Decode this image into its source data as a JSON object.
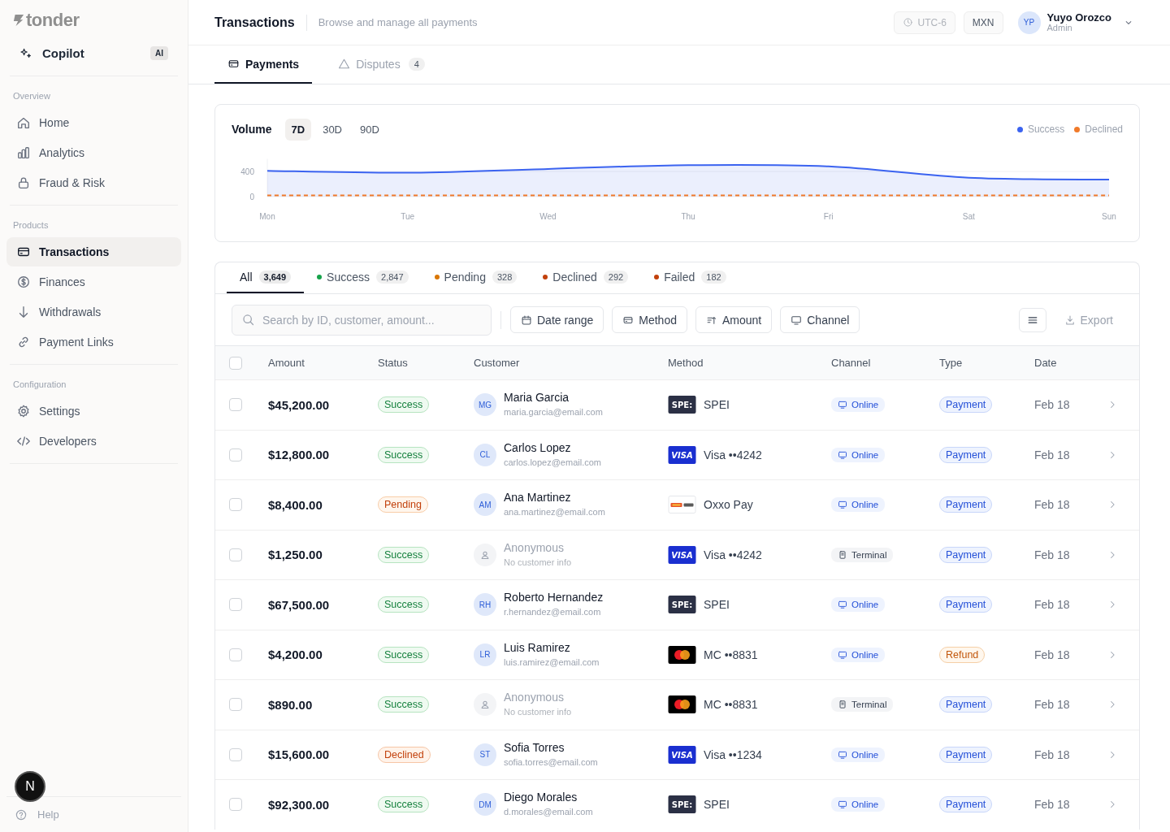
{
  "brand": {
    "name": "tonder"
  },
  "copilot": {
    "label": "Copilot",
    "badge": "AI"
  },
  "nav": [
    {
      "heading": "Overview",
      "items": [
        {
          "label": "Home",
          "selected": false
        },
        {
          "label": "Analytics",
          "selected": false
        },
        {
          "label": "Fraud & Risk",
          "selected": false
        }
      ]
    },
    {
      "heading": "Products",
      "items": [
        {
          "label": "Transactions",
          "selected": true
        },
        {
          "label": "Finances",
          "selected": false
        },
        {
          "label": "Withdrawals",
          "selected": false
        },
        {
          "label": "Payment Links",
          "selected": false
        }
      ]
    },
    {
      "heading": "Configuration",
      "items": [
        {
          "label": "Settings",
          "selected": false
        },
        {
          "label": "Developers",
          "selected": false
        }
      ]
    }
  ],
  "help": {
    "label": "Help"
  },
  "dev_badge": {
    "label": "N"
  },
  "header": {
    "title": "Transactions",
    "subtitle": "Browse and manage all payments",
    "timezone": "UTC-6",
    "currency": "MXN",
    "user": {
      "initials": "YP",
      "name": "Yuyo Orozco",
      "role": "Admin"
    }
  },
  "page_tabs": [
    {
      "label": "Payments",
      "selected": true
    },
    {
      "label": "Disputes",
      "count": "4",
      "selected": false
    }
  ],
  "volume": {
    "title": "Volume",
    "ranges": [
      {
        "label": "7D",
        "selected": true
      },
      {
        "label": "30D",
        "selected": false
      },
      {
        "label": "90D",
        "selected": false
      }
    ],
    "chart_data": {
      "type": "area",
      "categories": [
        "Mon",
        "Tue",
        "Wed",
        "Thu",
        "Fri",
        "Sat",
        "Sun"
      ],
      "ylim": [
        0,
        600
      ],
      "yticks": [
        0,
        400
      ],
      "series": [
        {
          "name": "Success",
          "type": "area",
          "line_style": "solid",
          "color": "#3b63f0",
          "values": [
            410,
            380,
            440,
            500,
            480,
            300,
            270
          ]
        },
        {
          "name": "Declined",
          "type": "line",
          "line_style": "dashed",
          "color": "#f07a2a",
          "values": [
            20,
            20,
            20,
            20,
            20,
            20,
            20
          ]
        }
      ]
    }
  },
  "status_tabs": [
    {
      "label": "All",
      "count": "3,649",
      "selected": true
    },
    {
      "label": "Success",
      "count": "2,847",
      "color": "#16a34a",
      "selected": false
    },
    {
      "label": "Pending",
      "count": "328",
      "color": "#d97706",
      "selected": false
    },
    {
      "label": "Declined",
      "count": "292",
      "color": "#c2410c",
      "selected": false
    },
    {
      "label": "Failed",
      "count": "182",
      "color": "#c2410c",
      "selected": false
    }
  ],
  "toolbar": {
    "search_placeholder": "Search by ID, customer, amount...",
    "filters": [
      {
        "label": "Date range"
      },
      {
        "label": "Method"
      },
      {
        "label": "Amount"
      },
      {
        "label": "Channel"
      }
    ],
    "export": "Export"
  },
  "table": {
    "select_all_checked": false,
    "columns": [
      "Amount",
      "Status",
      "Customer",
      "Method",
      "Channel",
      "Type",
      "Date"
    ],
    "rows": [
      {
        "checked": false,
        "amount": "$45,200.00",
        "status": {
          "label": "Success",
          "kind": "success"
        },
        "customer": {
          "initials": "MG",
          "name": "Maria Garcia",
          "email": "maria.garcia@email.com",
          "anonymous": false
        },
        "method": {
          "kind": "spei",
          "logo_text": "SPE:",
          "label": "SPEI"
        },
        "channel": {
          "label": "Online",
          "kind": "online"
        },
        "type": {
          "label": "Payment",
          "kind": "payment"
        },
        "date": "Feb 18"
      },
      {
        "checked": false,
        "amount": "$12,800.00",
        "status": {
          "label": "Success",
          "kind": "success"
        },
        "customer": {
          "initials": "CL",
          "name": "Carlos Lopez",
          "email": "carlos.lopez@email.com",
          "anonymous": false
        },
        "method": {
          "kind": "visa",
          "logo_text": "VISA",
          "label": "Visa ••4242"
        },
        "channel": {
          "label": "Online",
          "kind": "online"
        },
        "type": {
          "label": "Payment",
          "kind": "payment"
        },
        "date": "Feb 18"
      },
      {
        "checked": false,
        "amount": "$8,400.00",
        "status": {
          "label": "Pending",
          "kind": "pending"
        },
        "customer": {
          "initials": "AM",
          "name": "Ana Martinez",
          "email": "ana.martinez@email.com",
          "anonymous": false
        },
        "method": {
          "kind": "oxxo",
          "label": "Oxxo Pay"
        },
        "channel": {
          "label": "Online",
          "kind": "online"
        },
        "type": {
          "label": "Payment",
          "kind": "payment"
        },
        "date": "Feb 18"
      },
      {
        "checked": false,
        "amount": "$1,250.00",
        "status": {
          "label": "Success",
          "kind": "success"
        },
        "customer": {
          "name": "Anonymous",
          "email": "No customer info",
          "anonymous": true
        },
        "method": {
          "kind": "visa",
          "logo_text": "VISA",
          "label": "Visa ••4242"
        },
        "channel": {
          "label": "Terminal",
          "kind": "terminal"
        },
        "type": {
          "label": "Payment",
          "kind": "payment"
        },
        "date": "Feb 18"
      },
      {
        "checked": false,
        "amount": "$67,500.00",
        "status": {
          "label": "Success",
          "kind": "success"
        },
        "customer": {
          "initials": "RH",
          "name": "Roberto Hernandez",
          "email": "r.hernandez@email.com",
          "anonymous": false
        },
        "method": {
          "kind": "spei",
          "logo_text": "SPE:",
          "label": "SPEI"
        },
        "channel": {
          "label": "Online",
          "kind": "online"
        },
        "type": {
          "label": "Payment",
          "kind": "payment"
        },
        "date": "Feb 18"
      },
      {
        "checked": false,
        "amount": "$4,200.00",
        "status": {
          "label": "Success",
          "kind": "success"
        },
        "customer": {
          "initials": "LR",
          "name": "Luis Ramirez",
          "email": "luis.ramirez@email.com",
          "anonymous": false
        },
        "method": {
          "kind": "mastercard",
          "label": "MC ••8831"
        },
        "channel": {
          "label": "Online",
          "kind": "online"
        },
        "type": {
          "label": "Refund",
          "kind": "refund"
        },
        "date": "Feb 18"
      },
      {
        "checked": false,
        "amount": "$890.00",
        "status": {
          "label": "Success",
          "kind": "success"
        },
        "customer": {
          "name": "Anonymous",
          "email": "No customer info",
          "anonymous": true
        },
        "method": {
          "kind": "mastercard",
          "label": "MC ••8831"
        },
        "channel": {
          "label": "Terminal",
          "kind": "terminal"
        },
        "type": {
          "label": "Payment",
          "kind": "payment"
        },
        "date": "Feb 18"
      },
      {
        "checked": false,
        "amount": "$15,600.00",
        "status": {
          "label": "Declined",
          "kind": "declined"
        },
        "customer": {
          "initials": "ST",
          "name": "Sofia Torres",
          "email": "sofia.torres@email.com",
          "anonymous": false
        },
        "method": {
          "kind": "visa",
          "logo_text": "VISA",
          "label": "Visa ••1234"
        },
        "channel": {
          "label": "Online",
          "kind": "online"
        },
        "type": {
          "label": "Payment",
          "kind": "payment"
        },
        "date": "Feb 18"
      },
      {
        "checked": false,
        "amount": "$92,300.00",
        "status": {
          "label": "Success",
          "kind": "success"
        },
        "customer": {
          "initials": "DM",
          "name": "Diego Morales",
          "email": "d.morales@email.com",
          "anonymous": false
        },
        "method": {
          "kind": "spei",
          "logo_text": "SPE:",
          "label": "SPEI"
        },
        "channel": {
          "label": "Online",
          "kind": "online"
        },
        "type": {
          "label": "Payment",
          "kind": "payment"
        },
        "date": "Feb 18"
      }
    ]
  }
}
